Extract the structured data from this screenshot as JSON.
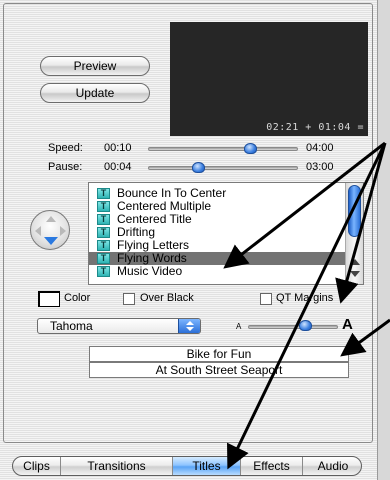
{
  "preview": {
    "button_label": "Preview",
    "update_label": "Update",
    "timecode": "02:21 + 01:04 ="
  },
  "speed": {
    "label": "Speed:",
    "min": "00:10",
    "max": "04:00",
    "value_fraction": 0.68
  },
  "pause": {
    "label": "Pause:",
    "min": "00:04",
    "max": "03:00",
    "value_fraction": 0.33
  },
  "direction_control": {
    "icon": "direction-pad-icon",
    "selected": "down"
  },
  "titles_list": {
    "items": [
      "Bounce In To Center",
      "Centered Multiple",
      "Centered Title",
      "Drifting",
      "Flying Letters",
      "Flying Words",
      "Music Video"
    ],
    "selected": "Flying Words",
    "item_icon": "title-t-icon",
    "scroll_fraction": 0.0
  },
  "options": {
    "color_label": "Color",
    "over_black_label": "Over Black",
    "qt_margins_label": "QT Margins"
  },
  "font": {
    "selected": "Tahoma",
    "size_small_glyph": "A",
    "size_large_glyph": "A",
    "size_fraction": 0.63
  },
  "text_fields": {
    "line1": "Bike for Fun",
    "line2": "At South Street Seaport"
  },
  "tabs": [
    {
      "label": "Clips",
      "active": false
    },
    {
      "label": "Transitions",
      "active": false
    },
    {
      "label": "Titles",
      "active": true
    },
    {
      "label": "Effects",
      "active": false
    },
    {
      "label": "Audio",
      "active": false
    }
  ],
  "colors": {
    "accent": "#3b7fe0",
    "selection": "#737373",
    "preview_bg": "#262626",
    "tab_active": "#8ec4ff"
  }
}
